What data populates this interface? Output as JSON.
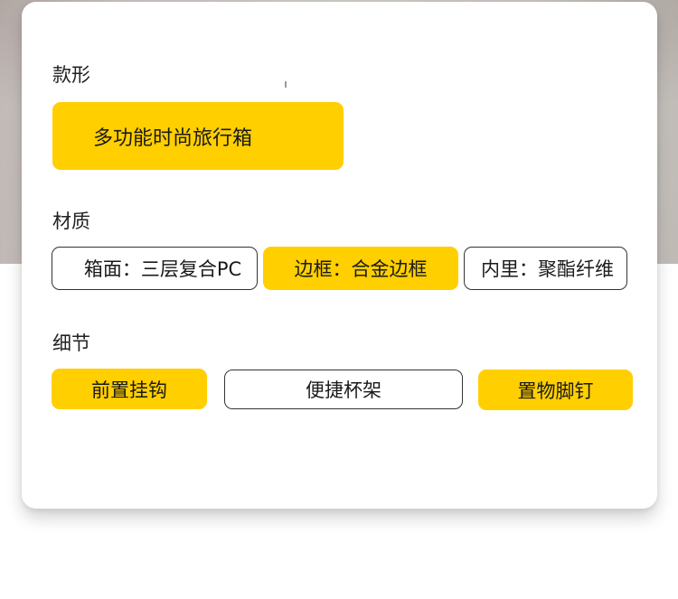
{
  "style": {
    "title": "款形",
    "options": [
      {
        "label": "多功能时尚旅行箱",
        "selected": true
      }
    ]
  },
  "material": {
    "title": "材质",
    "options": [
      {
        "label": "箱面：三层复合PC",
        "selected": false
      },
      {
        "label": "边框：合金边框",
        "selected": true
      },
      {
        "label": "内里：聚酯纤维",
        "selected": false
      }
    ]
  },
  "details": {
    "title": "细节",
    "options": [
      {
        "label": "前置挂钩",
        "selected": true
      },
      {
        "label": "便捷杯架",
        "selected": false
      },
      {
        "label": "置物脚钉",
        "selected": true
      }
    ]
  },
  "colors": {
    "accent": "#ffcf00",
    "border": "#333333",
    "text": "#1a1a1a"
  }
}
